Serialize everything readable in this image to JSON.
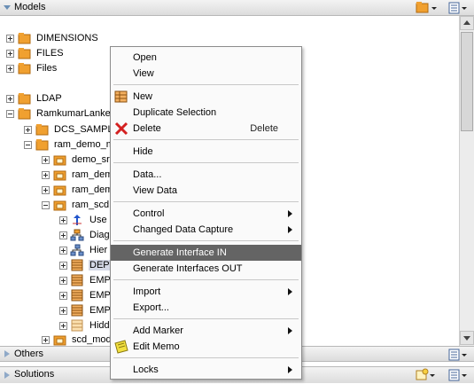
{
  "panels": {
    "models": {
      "title": "Models"
    },
    "others": {
      "title": "Others"
    },
    "solutions": {
      "title": "Solutions"
    }
  },
  "tree": {
    "dimensions": "DIMENSIONS",
    "files_folder": "FILES",
    "files": "Files",
    "ldap": "LDAP",
    "ramkumar": "RamkumarLanke",
    "dcs_sample": "DCS_SAMPLE",
    "ram_demo": "ram_demo_m",
    "demo_sr": "demo_sr",
    "ram_dem_1": "ram_dem",
    "ram_dem_2": "ram_dem",
    "ram_scd": "ram_scd",
    "use": "Use",
    "diag": "Diag",
    "hier": "Hier",
    "dept": "DEPT",
    "emp1": "EMP",
    "emp2": "EMP",
    "emp3": "EMP",
    "hidd": "Hidd",
    "scd_mod": "scd_mod"
  },
  "menu": {
    "open": "Open",
    "view": "View",
    "new": "New",
    "duplicate": "Duplicate Selection",
    "delete": "Delete",
    "delete_accel": "Delete",
    "hide": "Hide",
    "data": "Data...",
    "view_data": "View Data",
    "control": "Control",
    "cdc": "Changed Data Capture",
    "gen_in": "Generate Interface IN",
    "gen_out": "Generate Interfaces OUT",
    "import": "Import",
    "export": "Export...",
    "add_marker": "Add Marker",
    "edit_memo": "Edit Memo",
    "locks": "Locks"
  },
  "colors": {
    "folder": "#f0a030",
    "highlight": "#646464",
    "delete_red": "#d42020"
  }
}
